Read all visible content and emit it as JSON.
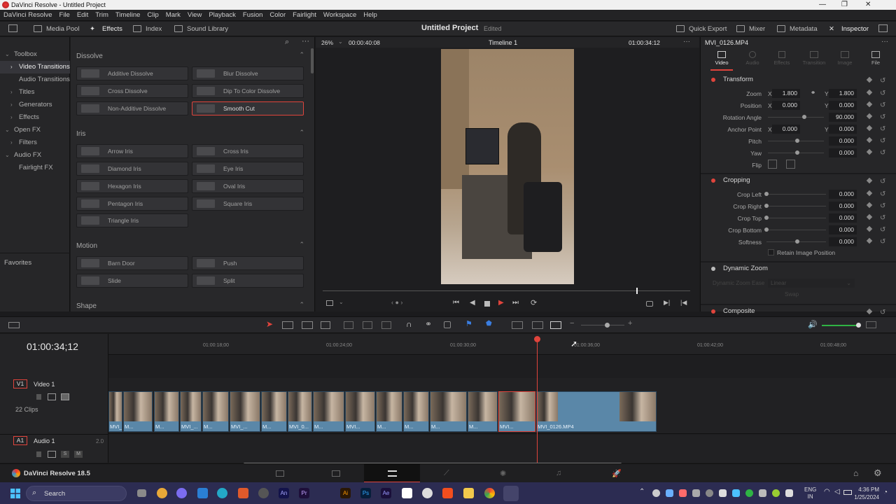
{
  "window": {
    "title": "DaVinci Resolve - Untitled Project",
    "controls": [
      "—",
      "❐",
      "✕"
    ]
  },
  "menu": [
    "DaVinci Resolve",
    "File",
    "Edit",
    "Trim",
    "Timeline",
    "Clip",
    "Mark",
    "View",
    "Playback",
    "Fusion",
    "Color",
    "Fairlight",
    "Workspace",
    "Help"
  ],
  "toolbar": {
    "media_pool": "Media Pool",
    "effects": "Effects",
    "index": "Index",
    "sound_library": "Sound Library",
    "project_title": "Untitled Project",
    "edited": "Edited",
    "quick_export": "Quick Export",
    "mixer": "Mixer",
    "metadata": "Metadata",
    "inspector": "Inspector"
  },
  "sidebar": {
    "items": [
      {
        "label": "Toolbox",
        "arrow": "⌄"
      },
      {
        "label": "Video Transitions",
        "arrow": "›"
      },
      {
        "label": "Audio Transitions",
        "arrow": ""
      },
      {
        "label": "Titles",
        "arrow": "›"
      },
      {
        "label": "Generators",
        "arrow": "›"
      },
      {
        "label": "Effects",
        "arrow": "›"
      },
      {
        "label": "Open FX",
        "arrow": "⌄"
      },
      {
        "label": "Filters",
        "arrow": "›"
      },
      {
        "label": "Audio FX",
        "arrow": "⌄"
      },
      {
        "label": "Fairlight FX",
        "arrow": ""
      }
    ],
    "favorites": "Favorites"
  },
  "effects": {
    "dissolve": {
      "title": "Dissolve",
      "items": [
        "Additive Dissolve",
        "Blur Dissolve",
        "Cross Dissolve",
        "Dip To Color Dissolve",
        "Non-Additive Dissolve",
        "Smooth Cut"
      ]
    },
    "iris": {
      "title": "Iris",
      "items": [
        "Arrow Iris",
        "Cross Iris",
        "Diamond Iris",
        "Eye Iris",
        "Hexagon Iris",
        "Oval Iris",
        "Pentagon Iris",
        "Square Iris",
        "Triangle Iris"
      ]
    },
    "motion": {
      "title": "Motion",
      "items": [
        "Barn Door",
        "Push",
        "Slide",
        "Split"
      ]
    },
    "shape": {
      "title": "Shape"
    }
  },
  "viewer": {
    "zoom": "26%",
    "duration": "00:00:40:08",
    "timeline_name": "Timeline 1",
    "timecode": "01:00:34:12"
  },
  "inspector": {
    "clip_name": "MVI_0126.MP4",
    "tabs": [
      "Video",
      "Audio",
      "Effects",
      "Transition",
      "Image",
      "File"
    ],
    "transform": {
      "title": "Transform",
      "zoom_label": "Zoom",
      "zoom_x": "1.800",
      "zoom_y": "1.800",
      "position_label": "Position",
      "pos_x": "0.000",
      "pos_y": "0.000",
      "rotation_label": "Rotation Angle",
      "rotation": "90.000",
      "anchor_label": "Anchor Point",
      "anchor_x": "0.000",
      "anchor_y": "0.000",
      "pitch_label": "Pitch",
      "pitch": "0.000",
      "yaw_label": "Yaw",
      "yaw": "0.000",
      "flip_label": "Flip",
      "x": "X",
      "y": "Y"
    },
    "cropping": {
      "title": "Cropping",
      "left_label": "Crop Left",
      "left": "0.000",
      "right_label": "Crop Right",
      "right": "0.000",
      "top_label": "Crop Top",
      "top": "0.000",
      "bottom_label": "Crop Bottom",
      "bottom": "0.000",
      "soft_label": "Softness",
      "soft": "0.000",
      "retain": "Retain Image Position"
    },
    "dynamic_zoom": {
      "title": "Dynamic Zoom",
      "ease_label": "Dynamic Zoom Ease",
      "ease": "Linear",
      "swap": "Swap"
    },
    "composite": {
      "title": "Composite"
    }
  },
  "timeline": {
    "timecode": "01:00:34;12",
    "ruler": [
      "01:00:18;00",
      "01:00:24;00",
      "01:00:30;00",
      "01:00:36;00",
      "01:00:42;00",
      "01:00:48;00"
    ],
    "v1": {
      "tag": "V1",
      "name": "Video 1",
      "clips_count": "22 Clips"
    },
    "a1": {
      "tag": "A1",
      "name": "Audio 1",
      "level": "2.0",
      "s": "S",
      "m": "M"
    },
    "clips": [
      "MVI_...",
      "M...",
      "M...",
      "MVI_...",
      "M...",
      "MVI_...",
      "M...",
      "MVI_0...",
      "M...",
      "MVI...",
      "M...",
      "M...",
      "M...",
      "M...",
      "MVI...",
      "M...",
      "MVI_0126.MP4"
    ]
  },
  "bottom": {
    "app": "DaVinci Resolve 18.5"
  },
  "taskbar": {
    "search": "Search",
    "lang1": "ENG",
    "lang2": "IN",
    "time": "4:36 PM",
    "date": "1/25/2024",
    "icons": [
      "An",
      "Pr",
      "Ai",
      "Ps",
      "Ae"
    ]
  },
  "colors": {
    "accent_red": "#e0443c",
    "clip_blue": "#5a87a8",
    "taskbar": "#2c2c52"
  }
}
